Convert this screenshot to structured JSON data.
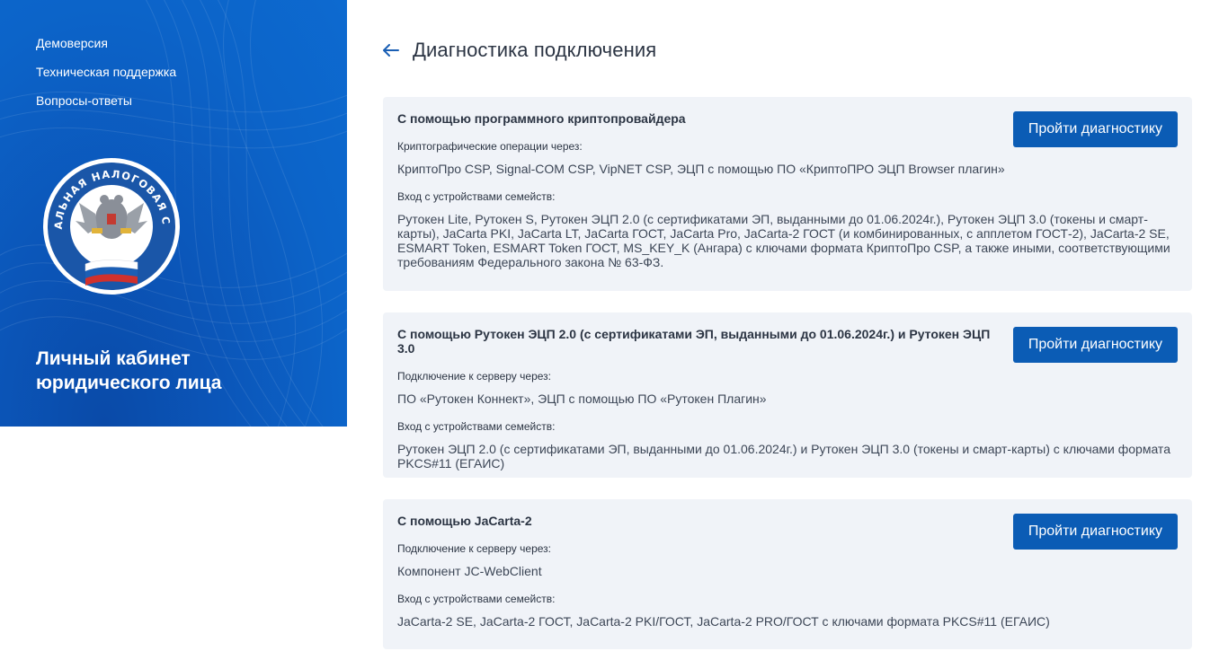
{
  "sidebar": {
    "nav": [
      {
        "label": "Демоверсия"
      },
      {
        "label": "Техническая поддержка"
      },
      {
        "label": "Вопросы-ответы"
      }
    ],
    "emblem_text": "ФЕДЕРАЛЬНАЯ НАЛОГОВАЯ СЛУЖБА",
    "cabinet_title": "Личный кабинет юридического лица"
  },
  "page": {
    "title": "Диагностика подключения"
  },
  "cards": [
    {
      "title": "С помощью программного криптопровайдера",
      "button": "Пройти диагностику",
      "label1": "Криптографические операции через:",
      "text1": "КриптоПро CSP, Signal-COM CSP, VipNET CSP, ЭЦП с помощью ПО «КриптоПРО ЭЦП Browser плагин»",
      "label2": "Вход с устройствами семейств:",
      "text2": "Рутокен Lite, Рутокен S, Рутокен ЭЦП 2.0 (с сертификатами ЭП, выданными до 01.06.2024г.), Рутокен ЭЦП 3.0 (токены и смарт-карты), JaCarta PKI, JaCarta LT, JaCarta ГОСТ, JaCarta Pro, JaCarta-2 ГОСТ (и комбинированных, с апплетом ГОСТ-2), JaCarta-2 SE, ESMART Token, ESMART Token ГОСТ, MS_KEY_K (Ангара) с ключами формата КриптоПро CSP, а также иными, соответствующими требованиям Федерального закона № 63-ФЗ."
    },
    {
      "title": "С помощью Рутокен ЭЦП 2.0 (с сертификатами ЭП, выданными до 01.06.2024г.) и Рутокен ЭЦП 3.0",
      "button": "Пройти диагностику",
      "label1": "Подключение к серверу через:",
      "text1": "ПО «Рутокен Коннект», ЭЦП с помощью ПО «Рутокен Плагин»",
      "label2": "Вход с устройствами семейств:",
      "text2": "Рутокен ЭЦП 2.0 (с сертификатами ЭП, выданными до 01.06.2024г.) и Рутокен ЭЦП 3.0 (токены и смарт-карты) с ключами формата PKCS#11 (ЕГАИС)"
    },
    {
      "title": "С помощью JaCarta-2",
      "button": "Пройти диагностику",
      "label1": "Подключение к серверу через:",
      "text1": "Компонент JC-WebClient",
      "label2": "Вход с устройствами семейств:",
      "text2": "JaCarta-2 SE, JaCarta-2 ГОСТ, JaCarta-2 PKI/ГОСТ, JaCarta-2 PRO/ГОСТ с ключами формата PKCS#11 (ЕГАИС)"
    }
  ],
  "colors": {
    "sidebar_blue": "#0c64c9",
    "button_blue": "#0b5cb5",
    "card_bg": "#f0f3f8"
  }
}
